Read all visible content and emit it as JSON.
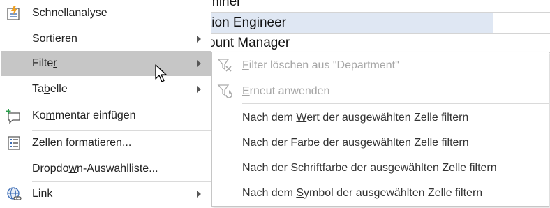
{
  "sheet": {
    "rows": [
      {
        "text": "miner",
        "selected": false
      },
      {
        "text": "tion Engineer",
        "selected": true
      },
      {
        "text": "ount Manager",
        "selected": false
      }
    ]
  },
  "context_menu": {
    "items": [
      {
        "pre": "",
        "u": "",
        "post": "Schnellanalyse",
        "icon": "quick-analysis-icon"
      },
      {
        "pre": "",
        "u": "S",
        "post": "ortieren",
        "icon": "",
        "submenu": true
      },
      {
        "pre": "Filte",
        "u": "r",
        "post": "",
        "icon": "",
        "submenu": true,
        "highlighted": true
      },
      {
        "pre": "Ta",
        "u": "b",
        "post": "elle",
        "icon": "",
        "submenu": true
      },
      {
        "pre": "Ko",
        "u": "m",
        "post": "mentar einfügen",
        "icon": "insert-comment-icon"
      },
      {
        "pre": "",
        "u": "Z",
        "post": "ellen formatieren...",
        "icon": "format-cells-icon"
      },
      {
        "pre": "Dropdo",
        "u": "w",
        "post": "n-Auswahlliste...",
        "icon": ""
      },
      {
        "pre": "Lin",
        "u": "k",
        "post": "",
        "icon": "link-icon",
        "submenu": true
      }
    ]
  },
  "filter_submenu": {
    "items": [
      {
        "pre": "",
        "u": "F",
        "post": "ilter löschen aus \"Department\"",
        "disabled": true,
        "icon": "clear-filter-icon"
      },
      {
        "pre": "",
        "u": "E",
        "post": "rneut anwenden",
        "disabled": true,
        "icon": "reapply-filter-icon"
      },
      {
        "pre": "Nach dem ",
        "u": "W",
        "post": "ert der ausgewählten Zelle filtern",
        "disabled": false,
        "icon": ""
      },
      {
        "pre": "Nach der ",
        "u": "F",
        "post": "arbe der ausgewählten Zelle filtern",
        "disabled": false,
        "icon": ""
      },
      {
        "pre": "Nach der ",
        "u": "S",
        "post": "chriftfarbe der ausgewählten Zelle filtern",
        "disabled": false,
        "icon": ""
      },
      {
        "pre": "Nach dem ",
        "u": "S",
        "post": "ymbol der ausgewählten Zelle filtern",
        "disabled": false,
        "icon": ""
      }
    ]
  }
}
